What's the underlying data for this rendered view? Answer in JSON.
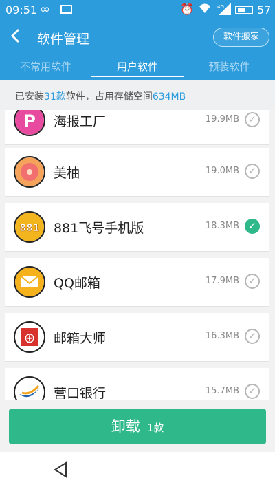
{
  "status_bar": {
    "time": "09:51",
    "battery": "57",
    "signal": "4G"
  },
  "header": {
    "title": "软件管理",
    "move_button": "软件搬家"
  },
  "tabs": [
    {
      "label": "不常用软件"
    },
    {
      "label": "用户软件"
    },
    {
      "label": "预装软件"
    }
  ],
  "summary": {
    "prefix": "已安装",
    "count": "31款",
    "middle": "软件，占用存储空间",
    "storage": "634MB"
  },
  "apps": [
    {
      "name": "海报工厂",
      "size": "19.9MB",
      "checked": false,
      "icon": "poster-factory-icon"
    },
    {
      "name": "美柚",
      "size": "19.0MB",
      "checked": false,
      "icon": "meiyou-icon"
    },
    {
      "name": "881飞号手机版",
      "size": "18.3MB",
      "checked": true,
      "icon": "881-icon"
    },
    {
      "name": "QQ邮箱",
      "size": "17.9MB",
      "checked": false,
      "icon": "qq-mail-icon"
    },
    {
      "name": "邮箱大师",
      "size": "16.3MB",
      "checked": false,
      "icon": "mail-master-icon"
    },
    {
      "name": "营口银行",
      "size": "15.7MB",
      "checked": false,
      "icon": "yingkou-bank-icon"
    }
  ],
  "uninstall": {
    "label": "卸载",
    "count": "1款"
  },
  "colors": {
    "primary": "#2d9cdc",
    "accent": "#2fb88a"
  }
}
